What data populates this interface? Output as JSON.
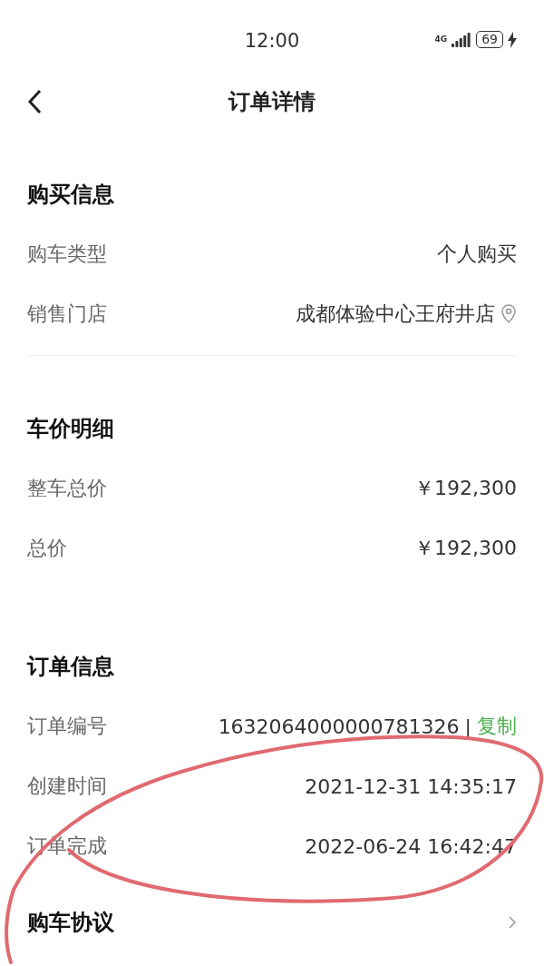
{
  "status_bar": {
    "time": "12:00",
    "network": "4G",
    "battery": "69",
    "charging": true
  },
  "header": {
    "title": "订单详情"
  },
  "sections": [
    {
      "title": "购买信息",
      "divider_below": true,
      "rows": [
        {
          "label": "购车类型",
          "value": "个人购买",
          "kind": "plain"
        },
        {
          "label": "销售门店",
          "value": "成都体验中心王府井店",
          "kind": "location"
        }
      ]
    },
    {
      "title": "车价明细",
      "rows": [
        {
          "label": "整车总价",
          "value": "￥192,300",
          "kind": "plain"
        },
        {
          "label": "总价",
          "value": "￥192,300",
          "kind": "plain"
        }
      ]
    },
    {
      "title": "订单信息",
      "rows": [
        {
          "label": "订单编号",
          "value": "1632064000000781326",
          "kind": "copy",
          "separator": "|",
          "action": "复制"
        },
        {
          "label": "创建时间",
          "value": "2021-12-31 14:35:17",
          "kind": "plain"
        },
        {
          "label": "订单完成",
          "value": "2022-06-24 16:42:47",
          "kind": "plain"
        }
      ]
    }
  ],
  "agreement": {
    "title": "购车协议"
  },
  "annotation": {
    "kind": "hand-drawn-loop",
    "color": "#e06a70"
  }
}
